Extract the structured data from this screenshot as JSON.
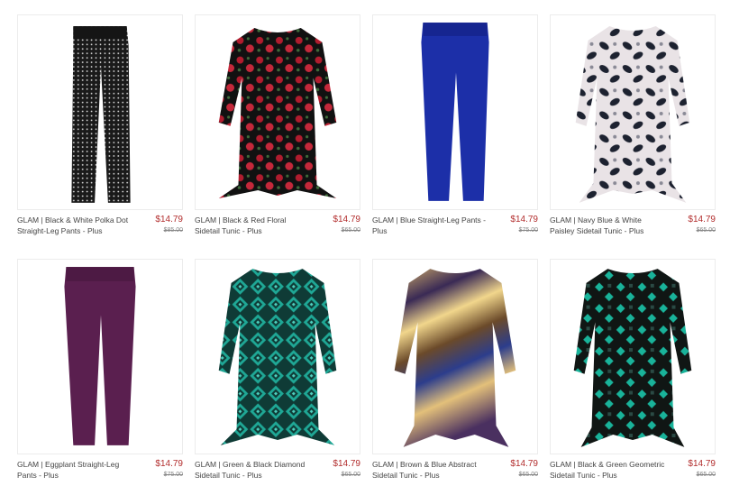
{
  "products": [
    {
      "title": "GLAM | Black & White Polka Dot Straight-Leg Pants - Plus",
      "price": "$14.79",
      "original_price": "$85.00",
      "image": "black-white-polka-dot-pants"
    },
    {
      "title": "GLAM | Black & Red Floral Sidetail Tunic - Plus",
      "price": "$14.79",
      "original_price": "$65.00",
      "image": "black-red-floral-tunic"
    },
    {
      "title": "GLAM | Blue Straight-Leg Pants - Plus",
      "price": "$14.79",
      "original_price": "$75.00",
      "image": "blue-pants"
    },
    {
      "title": "GLAM | Navy Blue & White Paisley Sidetail Tunic - Plus",
      "price": "$14.79",
      "original_price": "$65.00",
      "image": "navy-white-paisley-tunic"
    },
    {
      "title": "GLAM | Eggplant Straight-Leg Pants - Plus",
      "price": "$14.79",
      "original_price": "$75.00",
      "image": "eggplant-pants"
    },
    {
      "title": "GLAM | Green & Black Diamond Sidetail Tunic - Plus",
      "price": "$14.79",
      "original_price": "$65.00",
      "image": "green-black-diamond-tunic"
    },
    {
      "title": "GLAM | Brown & Blue Abstract Sidetail Tunic - Plus",
      "price": "$14.79",
      "original_price": "$65.00",
      "image": "brown-blue-abstract-tunic"
    },
    {
      "title": "GLAM | Black & Green Geometric Sidetail Tunic - Plus",
      "price": "$14.79",
      "original_price": "$65.00",
      "image": "black-green-geometric-tunic"
    }
  ],
  "colors": {
    "price": "#b22d2d",
    "title": "#444444",
    "original_price": "#888888"
  }
}
